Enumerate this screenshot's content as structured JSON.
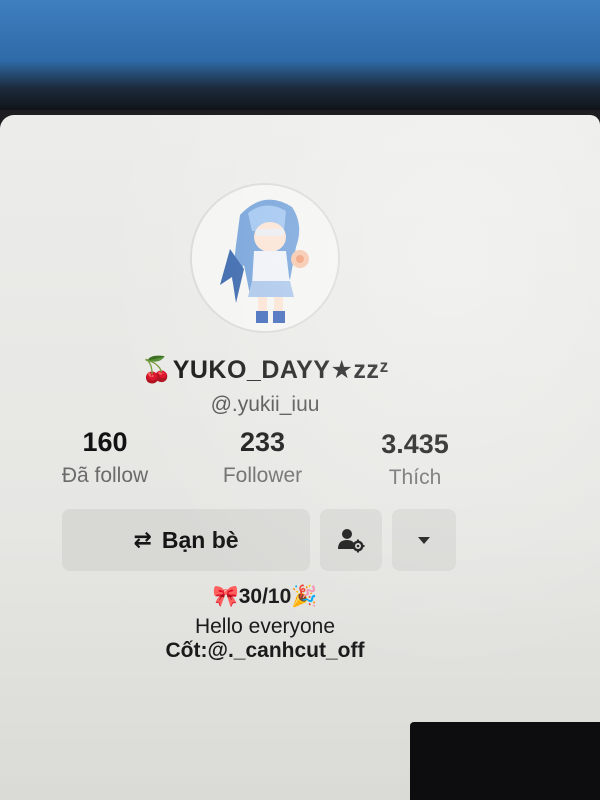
{
  "profile": {
    "display_name": "🍒YUKO_DAYY★zzᶻ",
    "username": "@.yukii_iuu"
  },
  "stats": [
    {
      "value": "160",
      "label": "Đã follow"
    },
    {
      "value": "233",
      "label": "Follower"
    },
    {
      "value": "3.435",
      "label": "Thích"
    }
  ],
  "actions": {
    "friends_icon": "⇄",
    "friends_label": "Bạn bè",
    "manage_icon": "person-gear-icon",
    "more_icon": "caret-down-icon"
  },
  "bio": {
    "line1": "🎀30/10🎉",
    "line2": "Hello everyone",
    "line3": "Cốt:@._canhcut_off"
  },
  "colors": {
    "background": "#e8e8e6",
    "button": "#d8d8d5",
    "text": "#121212",
    "muted": "#6b6b6b"
  }
}
